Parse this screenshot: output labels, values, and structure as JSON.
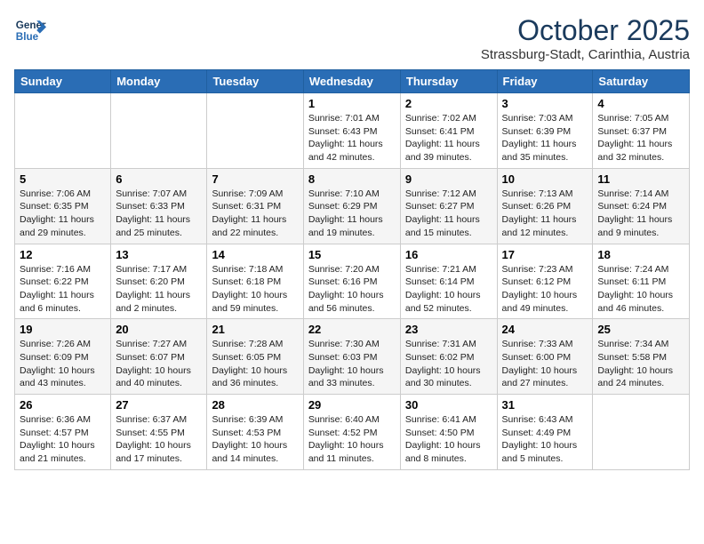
{
  "header": {
    "logo_line1": "General",
    "logo_line2": "Blue",
    "month": "October 2025",
    "location": "Strassburg-Stadt, Carinthia, Austria"
  },
  "weekdays": [
    "Sunday",
    "Monday",
    "Tuesday",
    "Wednesday",
    "Thursday",
    "Friday",
    "Saturday"
  ],
  "weeks": [
    [
      {
        "num": "",
        "info": ""
      },
      {
        "num": "",
        "info": ""
      },
      {
        "num": "",
        "info": ""
      },
      {
        "num": "1",
        "info": "Sunrise: 7:01 AM\nSunset: 6:43 PM\nDaylight: 11 hours\nand 42 minutes."
      },
      {
        "num": "2",
        "info": "Sunrise: 7:02 AM\nSunset: 6:41 PM\nDaylight: 11 hours\nand 39 minutes."
      },
      {
        "num": "3",
        "info": "Sunrise: 7:03 AM\nSunset: 6:39 PM\nDaylight: 11 hours\nand 35 minutes."
      },
      {
        "num": "4",
        "info": "Sunrise: 7:05 AM\nSunset: 6:37 PM\nDaylight: 11 hours\nand 32 minutes."
      }
    ],
    [
      {
        "num": "5",
        "info": "Sunrise: 7:06 AM\nSunset: 6:35 PM\nDaylight: 11 hours\nand 29 minutes."
      },
      {
        "num": "6",
        "info": "Sunrise: 7:07 AM\nSunset: 6:33 PM\nDaylight: 11 hours\nand 25 minutes."
      },
      {
        "num": "7",
        "info": "Sunrise: 7:09 AM\nSunset: 6:31 PM\nDaylight: 11 hours\nand 22 minutes."
      },
      {
        "num": "8",
        "info": "Sunrise: 7:10 AM\nSunset: 6:29 PM\nDaylight: 11 hours\nand 19 minutes."
      },
      {
        "num": "9",
        "info": "Sunrise: 7:12 AM\nSunset: 6:27 PM\nDaylight: 11 hours\nand 15 minutes."
      },
      {
        "num": "10",
        "info": "Sunrise: 7:13 AM\nSunset: 6:26 PM\nDaylight: 11 hours\nand 12 minutes."
      },
      {
        "num": "11",
        "info": "Sunrise: 7:14 AM\nSunset: 6:24 PM\nDaylight: 11 hours\nand 9 minutes."
      }
    ],
    [
      {
        "num": "12",
        "info": "Sunrise: 7:16 AM\nSunset: 6:22 PM\nDaylight: 11 hours\nand 6 minutes."
      },
      {
        "num": "13",
        "info": "Sunrise: 7:17 AM\nSunset: 6:20 PM\nDaylight: 11 hours\nand 2 minutes."
      },
      {
        "num": "14",
        "info": "Sunrise: 7:18 AM\nSunset: 6:18 PM\nDaylight: 10 hours\nand 59 minutes."
      },
      {
        "num": "15",
        "info": "Sunrise: 7:20 AM\nSunset: 6:16 PM\nDaylight: 10 hours\nand 56 minutes."
      },
      {
        "num": "16",
        "info": "Sunrise: 7:21 AM\nSunset: 6:14 PM\nDaylight: 10 hours\nand 52 minutes."
      },
      {
        "num": "17",
        "info": "Sunrise: 7:23 AM\nSunset: 6:12 PM\nDaylight: 10 hours\nand 49 minutes."
      },
      {
        "num": "18",
        "info": "Sunrise: 7:24 AM\nSunset: 6:11 PM\nDaylight: 10 hours\nand 46 minutes."
      }
    ],
    [
      {
        "num": "19",
        "info": "Sunrise: 7:26 AM\nSunset: 6:09 PM\nDaylight: 10 hours\nand 43 minutes."
      },
      {
        "num": "20",
        "info": "Sunrise: 7:27 AM\nSunset: 6:07 PM\nDaylight: 10 hours\nand 40 minutes."
      },
      {
        "num": "21",
        "info": "Sunrise: 7:28 AM\nSunset: 6:05 PM\nDaylight: 10 hours\nand 36 minutes."
      },
      {
        "num": "22",
        "info": "Sunrise: 7:30 AM\nSunset: 6:03 PM\nDaylight: 10 hours\nand 33 minutes."
      },
      {
        "num": "23",
        "info": "Sunrise: 7:31 AM\nSunset: 6:02 PM\nDaylight: 10 hours\nand 30 minutes."
      },
      {
        "num": "24",
        "info": "Sunrise: 7:33 AM\nSunset: 6:00 PM\nDaylight: 10 hours\nand 27 minutes."
      },
      {
        "num": "25",
        "info": "Sunrise: 7:34 AM\nSunset: 5:58 PM\nDaylight: 10 hours\nand 24 minutes."
      }
    ],
    [
      {
        "num": "26",
        "info": "Sunrise: 6:36 AM\nSunset: 4:57 PM\nDaylight: 10 hours\nand 21 minutes."
      },
      {
        "num": "27",
        "info": "Sunrise: 6:37 AM\nSunset: 4:55 PM\nDaylight: 10 hours\nand 17 minutes."
      },
      {
        "num": "28",
        "info": "Sunrise: 6:39 AM\nSunset: 4:53 PM\nDaylight: 10 hours\nand 14 minutes."
      },
      {
        "num": "29",
        "info": "Sunrise: 6:40 AM\nSunset: 4:52 PM\nDaylight: 10 hours\nand 11 minutes."
      },
      {
        "num": "30",
        "info": "Sunrise: 6:41 AM\nSunset: 4:50 PM\nDaylight: 10 hours\nand 8 minutes."
      },
      {
        "num": "31",
        "info": "Sunrise: 6:43 AM\nSunset: 4:49 PM\nDaylight: 10 hours\nand 5 minutes."
      },
      {
        "num": "",
        "info": ""
      }
    ]
  ]
}
